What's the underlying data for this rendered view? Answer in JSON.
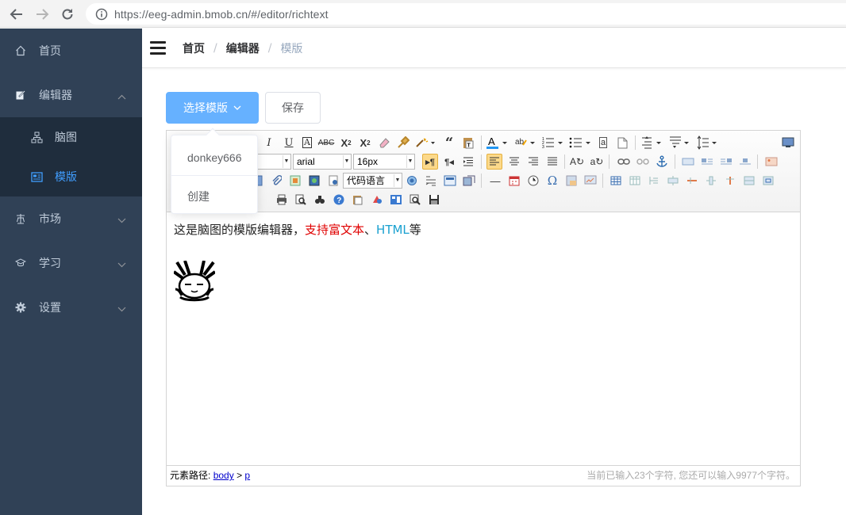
{
  "browser": {
    "url": "https://eeg-admin.bmob.cn/#/editor/richtext"
  },
  "sidebar": {
    "items": [
      {
        "label": "首页",
        "icon": "home-icon"
      },
      {
        "label": "编辑器",
        "icon": "edit-icon",
        "expanded": true,
        "children": [
          {
            "label": "脑图",
            "icon": "mindmap-icon",
            "active": false
          },
          {
            "label": "模版",
            "icon": "template-icon",
            "active": true
          }
        ]
      },
      {
        "label": "市场",
        "icon": "market-icon"
      },
      {
        "label": "学习",
        "icon": "study-icon"
      },
      {
        "label": "设置",
        "icon": "gear-icon"
      }
    ]
  },
  "navbar": {
    "breadcrumb": [
      "首页",
      "编辑器",
      "模版"
    ],
    "separator": "/"
  },
  "actions": {
    "select_template": "选择模版",
    "save": "保存"
  },
  "dropdown": {
    "items": [
      "donkey666",
      "创建"
    ]
  },
  "editor": {
    "toolbar": {
      "font_family": "arial",
      "font_size": "16px",
      "code_language": "代码语言"
    },
    "content": {
      "prefix": "这是脑图的模版编辑器，",
      "red_text": "支持富文本",
      "sep": "、",
      "cyan_text": "HTML",
      "suffix": "等"
    },
    "status": {
      "path_label": "元素路径:",
      "path_body": "body",
      "path_gt": ">",
      "path_p": "p",
      "count_text": "当前已输入23个字符, 您还可以输入9977个字符。"
    }
  },
  "colors": {
    "sidebar_bg": "#304156",
    "submenu_bg": "#1f2d3d",
    "active": "#409eff",
    "primary_button": "#66b1ff",
    "red_text": "#e00000",
    "cyan_text": "#1aa1d0"
  }
}
